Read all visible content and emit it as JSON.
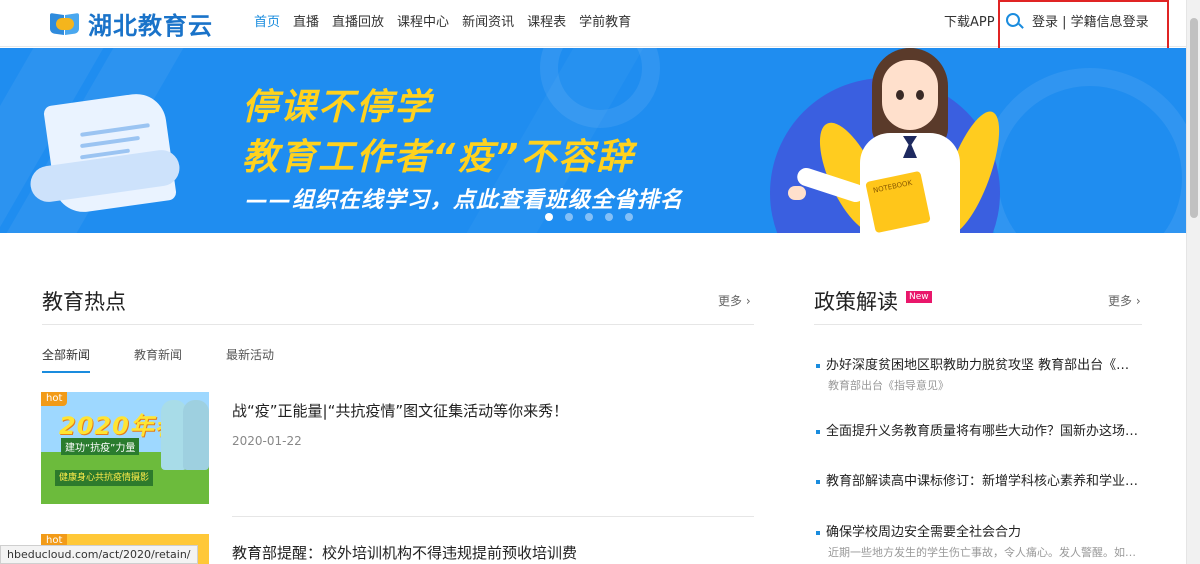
{
  "header": {
    "logo_text": "湖北教育云",
    "nav": [
      {
        "label": "首页",
        "active": true
      },
      {
        "label": "直播",
        "active": false
      },
      {
        "label": "直播回放",
        "active": false
      },
      {
        "label": "课程中心",
        "active": false
      },
      {
        "label": "新闻资讯",
        "active": false
      },
      {
        "label": "课程表",
        "active": false
      },
      {
        "label": "学前教育",
        "active": false
      }
    ],
    "download_app": "下载APP",
    "login_text": "登录 | 学籍信息登录"
  },
  "banner": {
    "slogan_line1": "停课不停学",
    "slogan_line2": "教育工作者“疫”不容辞",
    "slogan_line3": "——组织在线学习，点此查看班级全省排名",
    "book_label": "NOTEBOOK",
    "active_dot": 0,
    "dot_count": 5
  },
  "hot_section": {
    "title": "教育热点",
    "more": "更多",
    "tabs": [
      "全部新闻",
      "教育新闻",
      "最新活动"
    ],
    "active_tab": 0,
    "items": [
      {
        "badge": "hot",
        "thumb_text": "2020年春",
        "thumb_tag": "建功“抗疫”力量",
        "thumb_banner": "健康身心共抗疫情摄影",
        "title": "战“疫”正能量|“共抗疫情”图文征集活动等你来秀！",
        "date": "2020-01-22"
      },
      {
        "badge": "hot",
        "title": "教育部提醒：校外培训机构不得违规提前预收培训费",
        "date": ""
      }
    ]
  },
  "policy_section": {
    "title": "政策解读",
    "badge": "New",
    "more": "更多",
    "items": [
      {
        "title": "办好深度贫困地区职教助力脱贫攻坚 教育部出台《职业...",
        "sub": "教育部出台《指导意见》"
      },
      {
        "title": "全面提升义务教育质量将有哪些大动作？国新办这场发...",
        "sub": ""
      },
      {
        "title": "教育部解读高中课标修订：新增学科核心素养和学业质...",
        "sub": ""
      },
      {
        "title": "确保学校周边安全需要全社会合力",
        "sub": "近期一些地方发生的学生伤亡事故，令人痛心。发人警醒。如何确保学生在..."
      }
    ]
  },
  "status_bar": {
    "url": "hbeducloud.com/act/2020/retain/"
  },
  "colors": {
    "accent": "#1a8cde",
    "banner_bg": "#1f8df0",
    "slogan": "#ffd21e",
    "hot": "#f29b18",
    "new_badge": "#e9176b",
    "highlight_box": "#e02424"
  }
}
